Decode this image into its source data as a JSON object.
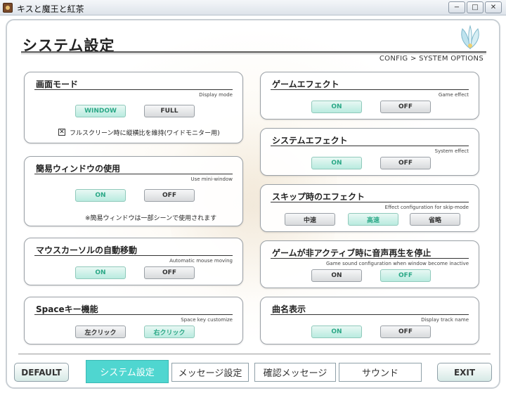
{
  "window": {
    "title": "キスと魔王と紅茶",
    "min": "−",
    "max": "□",
    "close": "✕"
  },
  "header": {
    "title": "システム設定",
    "subtitle": "CONFIG > SYSTEM OPTIONS"
  },
  "left": [
    {
      "title": "画面モード",
      "sub": "Display mode",
      "options": [
        "WINDOW",
        "FULL"
      ],
      "selected": 0,
      "check_label": "フルスクリーン時に縦横比を維持(ワイドモニター用)",
      "checked": true
    },
    {
      "title": "簡易ウィンドウの使用",
      "sub": "Use mini-window",
      "options": [
        "ON",
        "OFF"
      ],
      "selected": 0,
      "note": "※簡易ウィンドウは一部シーンで使用されます"
    },
    {
      "title": "マウスカーソルの自動移動",
      "sub": "Automatic mouse moving",
      "options": [
        "ON",
        "OFF"
      ],
      "selected": 0
    },
    {
      "title": "Spaceキー機能",
      "sub": "Space key customize",
      "options": [
        "左クリック",
        "右クリック"
      ],
      "selected": 1
    }
  ],
  "right": [
    {
      "title": "ゲームエフェクト",
      "sub": "Game effect",
      "options": [
        "ON",
        "OFF"
      ],
      "selected": 0
    },
    {
      "title": "システムエフェクト",
      "sub": "System effect",
      "options": [
        "ON",
        "OFF"
      ],
      "selected": 0
    },
    {
      "title": "スキップ時のエフェクト",
      "sub": "Effect configuration for skip-mode",
      "options": [
        "中速",
        "高速",
        "省略"
      ],
      "selected": 1
    },
    {
      "title": "ゲームが非アクティブ時に音声再生を停止",
      "sub": "Game sound configuration when window become inactive",
      "options": [
        "ON",
        "OFF"
      ],
      "selected": 1
    },
    {
      "title": "曲名表示",
      "sub": "Display track name",
      "options": [
        "ON",
        "OFF"
      ],
      "selected": 0
    }
  ],
  "bottom": {
    "default": "DEFAULT",
    "tabs": [
      "システム設定",
      "メッセージ設定",
      "確認メッセージ",
      "サウンド"
    ],
    "active_tab": 0,
    "exit": "EXIT"
  },
  "colors": {
    "accent": "#4fd6d0",
    "on_text": "#2aa886"
  }
}
